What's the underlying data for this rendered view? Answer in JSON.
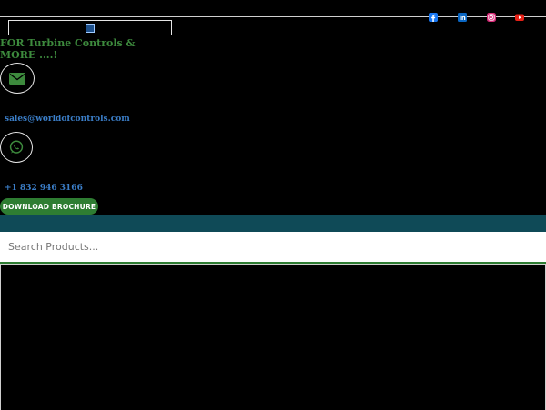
{
  "header": {
    "tagline": "FOR Turbine Controls & MORE ....!",
    "social": {
      "facebook": {
        "icon": "facebook-icon",
        "color": "#1877f2"
      },
      "linkedin": {
        "icon": "linkedin-icon",
        "color": "#0a66c2"
      },
      "instagram": {
        "icon": "instagram-icon",
        "color": "#e1306c"
      },
      "youtube": {
        "icon": "youtube-icon",
        "color": "#e62117"
      }
    }
  },
  "contact": {
    "email": "sales@worldofcontrols.com",
    "phone": "+1 832 946 3166"
  },
  "buttons": {
    "brochure": "DOWNLOAD BROCHURE"
  },
  "search": {
    "placeholder": "Search Products..."
  },
  "colors": {
    "accent_green": "#2e7d32",
    "teal_bar": "#0f4a57",
    "link_blue": "#3b7ec8"
  }
}
